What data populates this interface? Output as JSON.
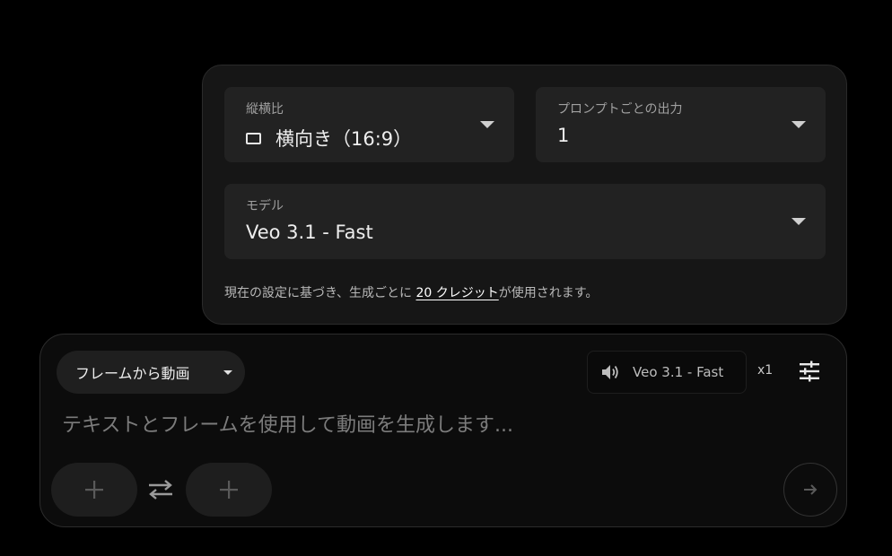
{
  "settings": {
    "aspect_ratio": {
      "label": "縦横比",
      "value": "横向き（16:9）",
      "icon": "landscape-rect-icon"
    },
    "outputs_per_prompt": {
      "label": "プロンプトごとの出力",
      "value": "1"
    },
    "model": {
      "label": "モデル",
      "value": "Veo 3.1 - Fast"
    },
    "credits_note": {
      "prefix": "現在の設定に基づき、生成ごとに ",
      "link": "20 クレジット",
      "suffix": "が使用されます。"
    }
  },
  "composer": {
    "mode_select": "フレームから動画",
    "model_chip": "Veo 3.1 - Fast",
    "count": "x1",
    "prompt_placeholder": "テキストとフレームを使用して動画を生成します..."
  },
  "colors": {
    "background": "#000000",
    "panel": "#161616",
    "field": "#222222",
    "accent_text": "#eeeeee"
  }
}
